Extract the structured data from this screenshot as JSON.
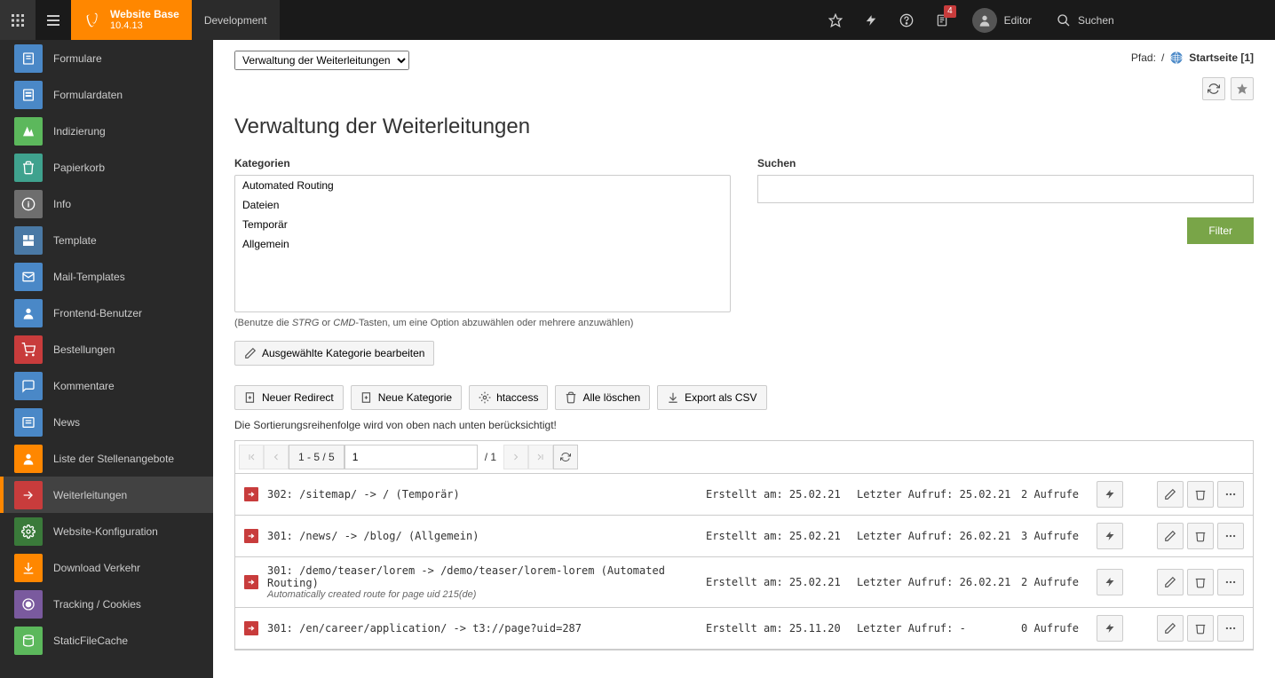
{
  "topbar": {
    "brand_line1": "Website Base",
    "brand_line2": "10.4.13",
    "environment": "Development",
    "notification_count": "4",
    "user_name": "Editor",
    "search_placeholder": "Suchen"
  },
  "sidebar": {
    "items": [
      {
        "label": "Formulare"
      },
      {
        "label": "Formulardaten"
      },
      {
        "label": "Indizierung"
      },
      {
        "label": "Papierkorb"
      },
      {
        "label": "Info"
      },
      {
        "label": "Template"
      },
      {
        "label": "Mail-Templates"
      },
      {
        "label": "Frontend-Benutzer"
      },
      {
        "label": "Bestellungen"
      },
      {
        "label": "Kommentare"
      },
      {
        "label": "News"
      },
      {
        "label": "Liste der Stellenangebote"
      },
      {
        "label": "Weiterleitungen"
      },
      {
        "label": "Website-Konfiguration"
      },
      {
        "label": "Download Verkehr"
      },
      {
        "label": "Tracking / Cookies"
      },
      {
        "label": "StaticFileCache"
      }
    ]
  },
  "path": {
    "label": "Pfad:",
    "sep": "/",
    "page": "Startseite [1]"
  },
  "module": {
    "selector": "Verwaltung der Weiterleitungen",
    "title": "Verwaltung der Weiterleitungen",
    "categories_label": "Kategorien",
    "categories": [
      "Automated Routing",
      "Dateien",
      "Temporär",
      "Allgemein"
    ],
    "hint_pre": "(Benutze die ",
    "hint_strg": "STRG",
    "hint_or": " or ",
    "hint_cmd": "CMD",
    "hint_post": "-Tasten, um eine Option abzuwählen oder mehrere anzuwählen)",
    "search_label": "Suchen",
    "filter_btn": "Filter",
    "edit_cat_btn": "Ausgewählte Kategorie bearbeiten",
    "actions": {
      "new_redirect": "Neuer Redirect",
      "new_category": "Neue Kategorie",
      "htaccess": "htaccess",
      "delete_all": "Alle löschen",
      "export_csv": "Export als CSV"
    },
    "sort_hint": "Die Sortierungsreihenfolge wird von oben nach unten berücksichtigt!"
  },
  "pager": {
    "range": "1 - 5 / 5",
    "page_input": "1",
    "total": "/ 1"
  },
  "rows": [
    {
      "title": "302: /sitemap/ -> / (Temporär)",
      "sub": "",
      "created": "Erstellt am: 25.02.21",
      "last": "Letzter Aufruf: 25.02.21",
      "calls": "2 Aufrufe"
    },
    {
      "title": "301: /news/ -> /blog/ (Allgemein)",
      "sub": "",
      "created": "Erstellt am: 25.02.21",
      "last": "Letzter Aufruf: 26.02.21",
      "calls": "3 Aufrufe"
    },
    {
      "title": "301: /demo/teaser/lorem -> /demo/teaser/lorem-lorem (Automated Routing)",
      "sub": "Automatically created route for page uid 215(de)",
      "created": "Erstellt am: 25.02.21",
      "last": "Letzter Aufruf: 26.02.21",
      "calls": "2 Aufrufe"
    },
    {
      "title": "301: /en/career/application/ -> t3://page?uid=287",
      "sub": "",
      "created": "Erstellt am: 25.11.20",
      "last": "Letzter Aufruf: -",
      "calls": "0 Aufrufe"
    }
  ]
}
